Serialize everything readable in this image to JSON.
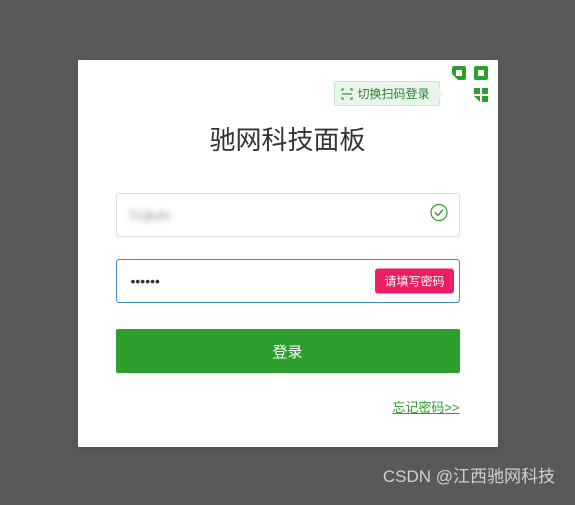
{
  "switch_tip": "切换扫码登录",
  "title": "驰网科技面板",
  "username": {
    "value": "51jkds",
    "validated": true
  },
  "password": {
    "value": "••••••",
    "error": "请填写密码"
  },
  "login_label": "登录",
  "forgot_label": "忘记密码>>",
  "watermark": "CSDN @江西驰网科技",
  "colors": {
    "primary_green": "#2e9e2e",
    "error_pink": "#e91e63"
  }
}
